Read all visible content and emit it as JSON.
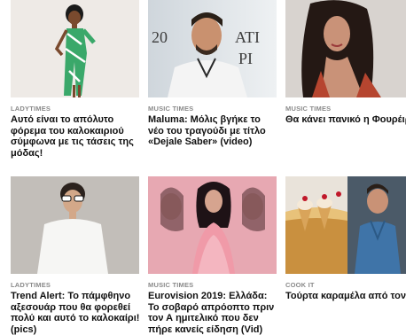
{
  "articles": [
    {
      "category": "LADYTIMES",
      "title": "Αυτό είναι το απόλυτο φόρεμα του καλοκαιριού σύμφωνα με τις τάσεις της μόδας!",
      "image": "woman-green-dress-photo"
    },
    {
      "category": "MUSIC TIMES",
      "title": "Maluma: Μόλις βγήκε το νέο του τραγούδι με τίτλο «Dejale Saber» (video)",
      "image": "maluma-portrait-photo",
      "image_text": "20 ATI PI"
    },
    {
      "category": "MUSIC TIMES",
      "title": "Θα κάνει πανικό η Φουρέιρα! Αυτά είναι τα νέα hits του καλοκαιριού! (video)",
      "image": "woman-long-dark-hair-photo"
    },
    {
      "category": "LADYTIMES",
      "title": "Trend Alert: Το πάμφθηνο αξεσουάρ που θα φορεθεί πολύ και αυτό το καλοκαίρι! (pics)",
      "image": "woman-sunglasses-photo"
    },
    {
      "category": "MUSIC TIMES",
      "title": "Eurovision 2019: Ελλάδα: Το σοβαρό απρόοπτο πριν τον Α ημιτελικό που δεν πήρε κανείς είδηση (Vid)",
      "image": "eurovision-pink-dress-photo"
    },
    {
      "category": "COOK IT",
      "title": "Τούρτα καραμέλα από τον Άκη Πετρετζίκη! (video)",
      "image": "caramel-cake-photo"
    }
  ],
  "colors": {
    "category_text": "#8a8a8a",
    "title_text": "#111111",
    "background": "#ffffff"
  }
}
